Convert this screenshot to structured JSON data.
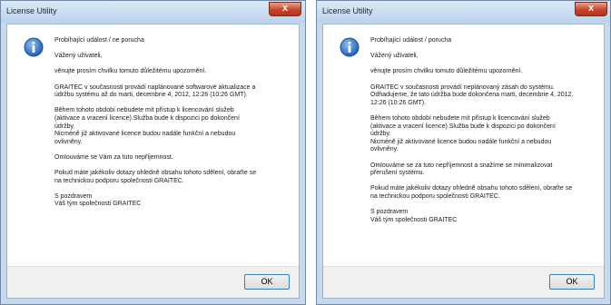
{
  "dialogs": [
    {
      "title": "License Utility",
      "close_glyph": "x",
      "icon": "info-icon",
      "paragraphs": [
        "Probíhající událost / ne porucha",
        "Vážený uživateli,",
        "věnujte prosím chvilku tomuto důležitému upozornění.",
        "GRAITEC v současnosti provádí naplánované softwarové aktualizace a\núdržbu systému až do marti, decembrie 4, 2012, 12:26 (10:26 GMT).",
        "Během tohoto období nebudete mít přístup k licencování služeb\n(aktivace a vracení licence).Služba bude k dispozici po dokončení\núdržby.\nNicméně již aktivované licence budou nadále funkční a nebudou\novlivněny.",
        "Omlouváme se Vám za tuto nepříjemnost.",
        "Pokud máte jakékoliv dotazy ohledně obsahu tohoto sdělení, obraťte se\nna technickou podporu společnosti GRAITEC.",
        "S pozdravem\nVáš tým společnosti GRAITEC"
      ],
      "ok_label": "OK"
    },
    {
      "title": "License Utility",
      "close_glyph": "x",
      "icon": "info-icon",
      "paragraphs": [
        "Probíhající událost / porucha",
        "Vážený uživateli,",
        "věnujte prosím chvilku tomuto důležitému upozornění.",
        "GRAITEC v současnosti provádí neplánovaný zásah do systému.\nOdhadujeme, že tato údržba bude dokončena marti, decembrie 4, 2012,\n12:26 (10:26 GMT).",
        "Během tohoto období nebudete mít přístup k licencování služeb\n(aktivace a vracení licence).Služba bude k dispozici po dokončení\núdržby.\nNicméně již aktivované licence budou nadále funkční a nebudou\novlivněny.",
        "Omlouváme se za tuto nepříjemnost a snažíme se minimalizovat\npřerušení systému.",
        "Pokud máte jakékoliv dotazy ohledně obsahu tohoto sdělení, obraťte se\nna technickou podporu společnosti GRAITEC.",
        "S pozdravem\nVáš tým společnosti GRAITEC"
      ],
      "ok_label": "OK"
    }
  ],
  "colors": {
    "frame": "#c7d9ec",
    "close_button": "#c7452a",
    "icon_blue": "#2f6fc4"
  }
}
